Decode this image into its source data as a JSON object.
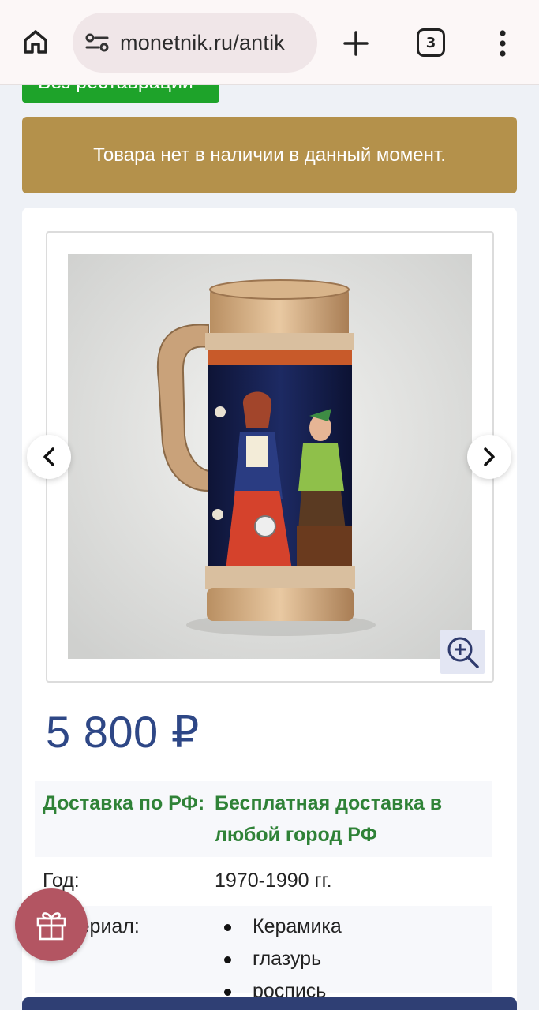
{
  "browser": {
    "url": "monetnik.ru/antik",
    "tab_count": "3"
  },
  "badge": {
    "label": "Без реставрации"
  },
  "stock_notice": "Товара нет в наличии в данный момент.",
  "product": {
    "price": "5 800 ₽",
    "attributes": {
      "delivery": {
        "label": "Доставка по РФ:",
        "value": "Бесплатная доставка в любой город РФ"
      },
      "year": {
        "label": "Год:",
        "value": "1970-1990 гг."
      },
      "material": {
        "label": "Материал:",
        "values": [
          "Керамика",
          "глазурь",
          "роспись"
        ]
      }
    }
  },
  "icons": {
    "home": "home-icon",
    "site_info": "tune-icon",
    "new_tab": "plus-icon",
    "menu": "kebab-menu-icon",
    "prev": "chevron-left-icon",
    "next": "chevron-right-icon",
    "zoom": "zoom-in-icon",
    "gift": "gift-icon"
  },
  "colors": {
    "badge_green": "#1ea32a",
    "banner_gold": "#b4914b",
    "price_blue": "#2e4786",
    "delivery_green": "#2f8237",
    "gift_fab": "#b35562"
  }
}
